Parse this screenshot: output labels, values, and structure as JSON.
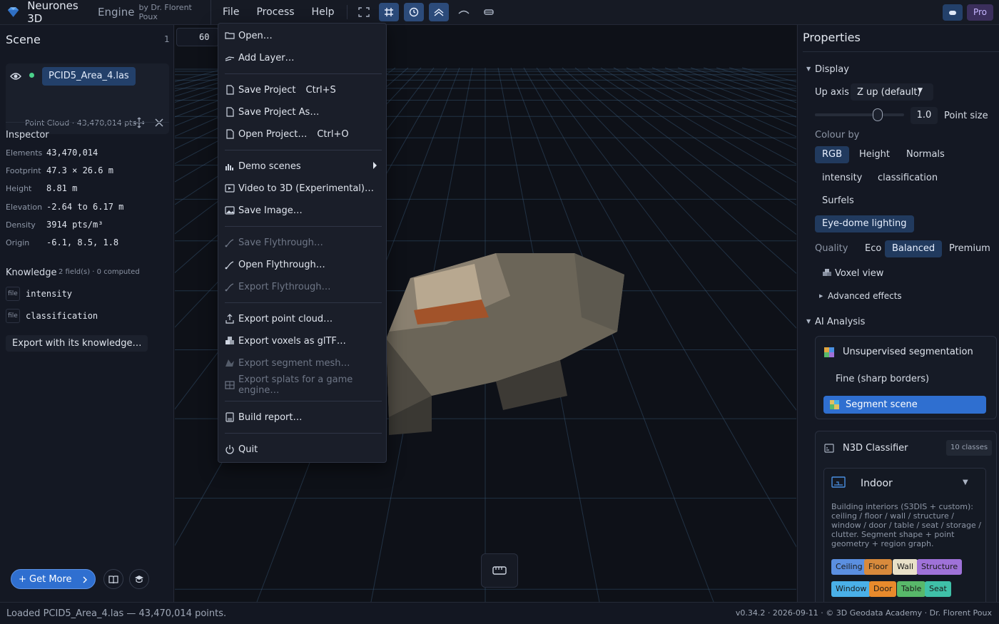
{
  "app": {
    "title": "Neurones 3D",
    "subtitle": "Engine",
    "author": "by Dr. Florent Poux"
  },
  "menubar": [
    "File",
    "Process",
    "Help"
  ],
  "toolbar_icons": [
    "fullscreen-icon",
    "grid-icon",
    "orbit-icon",
    "layers-icon",
    "curve-icon",
    "measure-icon"
  ],
  "topright": {
    "pro_label": "Pro"
  },
  "scene": {
    "title": "Scene",
    "count": "1",
    "layer": {
      "name": "PCID5_Area_4.las",
      "meta": "Point Cloud · 43,470,014 pts"
    }
  },
  "inspector": {
    "title": "Inspector",
    "rows": [
      {
        "label": "Elements",
        "value": "43,470,014"
      },
      {
        "label": "Footprint",
        "value": "47.3 × 26.6 m"
      },
      {
        "label": "Height",
        "value": "8.81 m"
      },
      {
        "label": "Elevation",
        "value": "-2.64 to 6.17 m"
      },
      {
        "label": "Density",
        "value": "3914 pts/m³"
      },
      {
        "label": "Origin",
        "value": "-6.1, 8.5, 1.8"
      }
    ]
  },
  "knowledge": {
    "title": "Knowledge",
    "meta": "2 field(s) · 0 computed",
    "fields": [
      {
        "tag": "file",
        "name": "intensity"
      },
      {
        "tag": "file",
        "name": "classification"
      }
    ],
    "export_label": "Export with its knowledge…"
  },
  "leftfooter": {
    "get_more": "+ Get More"
  },
  "viewport": {
    "fps": "60 F"
  },
  "file_menu": [
    {
      "label": "Open…",
      "icon": "folder-icon",
      "shortcut": "",
      "disabled": false
    },
    {
      "label": "Add Layer…",
      "icon": "layer-add-icon",
      "shortcut": "",
      "disabled": false
    },
    {
      "label": "Save Project",
      "icon": "file-icon",
      "shortcut": "Ctrl+S",
      "disabled": false
    },
    {
      "label": "Save Project As…",
      "icon": "file-icon",
      "shortcut": "",
      "disabled": false
    },
    {
      "label": "Open Project…",
      "icon": "file-icon",
      "shortcut": "Ctrl+O",
      "disabled": false
    },
    {
      "label": "Demo scenes",
      "icon": "chart-icon",
      "shortcut": "",
      "disabled": false
    },
    {
      "label": "Video to 3D (Experimental)…",
      "icon": "video-icon",
      "shortcut": "",
      "disabled": false
    },
    {
      "label": "Save Image…",
      "icon": "image-icon",
      "shortcut": "",
      "disabled": false
    },
    {
      "label": "Save Flythrough…",
      "icon": "path-icon",
      "shortcut": "",
      "disabled": true
    },
    {
      "label": "Open Flythrough…",
      "icon": "path-icon",
      "shortcut": "",
      "disabled": false
    },
    {
      "label": "Export Flythrough…",
      "icon": "path-icon",
      "shortcut": "",
      "disabled": true
    },
    {
      "label": "Export point cloud…",
      "icon": "export-icon",
      "shortcut": "",
      "disabled": false
    },
    {
      "label": "Export voxels as glTF…",
      "icon": "cube-icon",
      "shortcut": "",
      "disabled": false
    },
    {
      "label": "Export segment mesh…",
      "icon": "mesh-icon",
      "shortcut": "",
      "disabled": true
    },
    {
      "label": "Export splats for a game engine…",
      "icon": "splat-icon",
      "shortcut": "",
      "disabled": true
    },
    {
      "label": "Build report…",
      "icon": "report-icon",
      "shortcut": "",
      "disabled": false
    },
    {
      "label": "Quit",
      "icon": "power-icon",
      "shortcut": "",
      "disabled": false
    }
  ],
  "properties": {
    "title": "Properties",
    "display": {
      "title": "Display",
      "up_axis_label": "Up axis",
      "up_axis_value": "Z up (default)",
      "point_size_value": "1.0",
      "point_size_label": "Point size",
      "point_size_level": 0.7,
      "colour_by_label": "Colour by",
      "colour_options": [
        "RGB",
        "Height",
        "Normals",
        "intensity",
        "classification",
        "Surfels"
      ],
      "colour_selected": "RGB",
      "edl_label": "Eye-dome lighting",
      "quality_label": "Quality",
      "quality_options": [
        "Eco",
        "Balanced",
        "Premium"
      ],
      "quality_selected": "Balanced",
      "voxel_label": "Voxel view",
      "advanced_label": "Advanced effects"
    },
    "ai": {
      "title": "AI Analysis",
      "unsup_label": "Unsupervised segmentation",
      "fine_label": "Fine (sharp borders)",
      "segment_label": "Segment scene",
      "classifier_label": "N3D Classifier",
      "classes_badge": "10 classes",
      "preset_label": "Indoor",
      "preset_desc": "Building interiors (S3DIS + custom): ceiling / floor / wall / structure / window / door / table / seat / storage / clutter. Segment shape + point geometry + region graph.",
      "classes": [
        {
          "name": "Ceiling",
          "color": "#5b8fe0"
        },
        {
          "name": "Floor",
          "color": "#d88a3c"
        },
        {
          "name": "Wall",
          "color": "#e8e0c8"
        },
        {
          "name": "Structure",
          "color": "#9f72d8"
        },
        {
          "name": "Window",
          "color": "#4ab0e8"
        },
        {
          "name": "Door",
          "color": "#e88a2c"
        },
        {
          "name": "Table",
          "color": "#58b86a"
        },
        {
          "name": "Seat",
          "color": "#3fc0a8"
        }
      ]
    }
  },
  "status": {
    "left": "Loaded PCID5_Area_4.las — 43,470,014 points.",
    "right": "v0.34.2 · 2026-09-11 · © 3D Geodata Academy · Dr. Florent Poux"
  }
}
